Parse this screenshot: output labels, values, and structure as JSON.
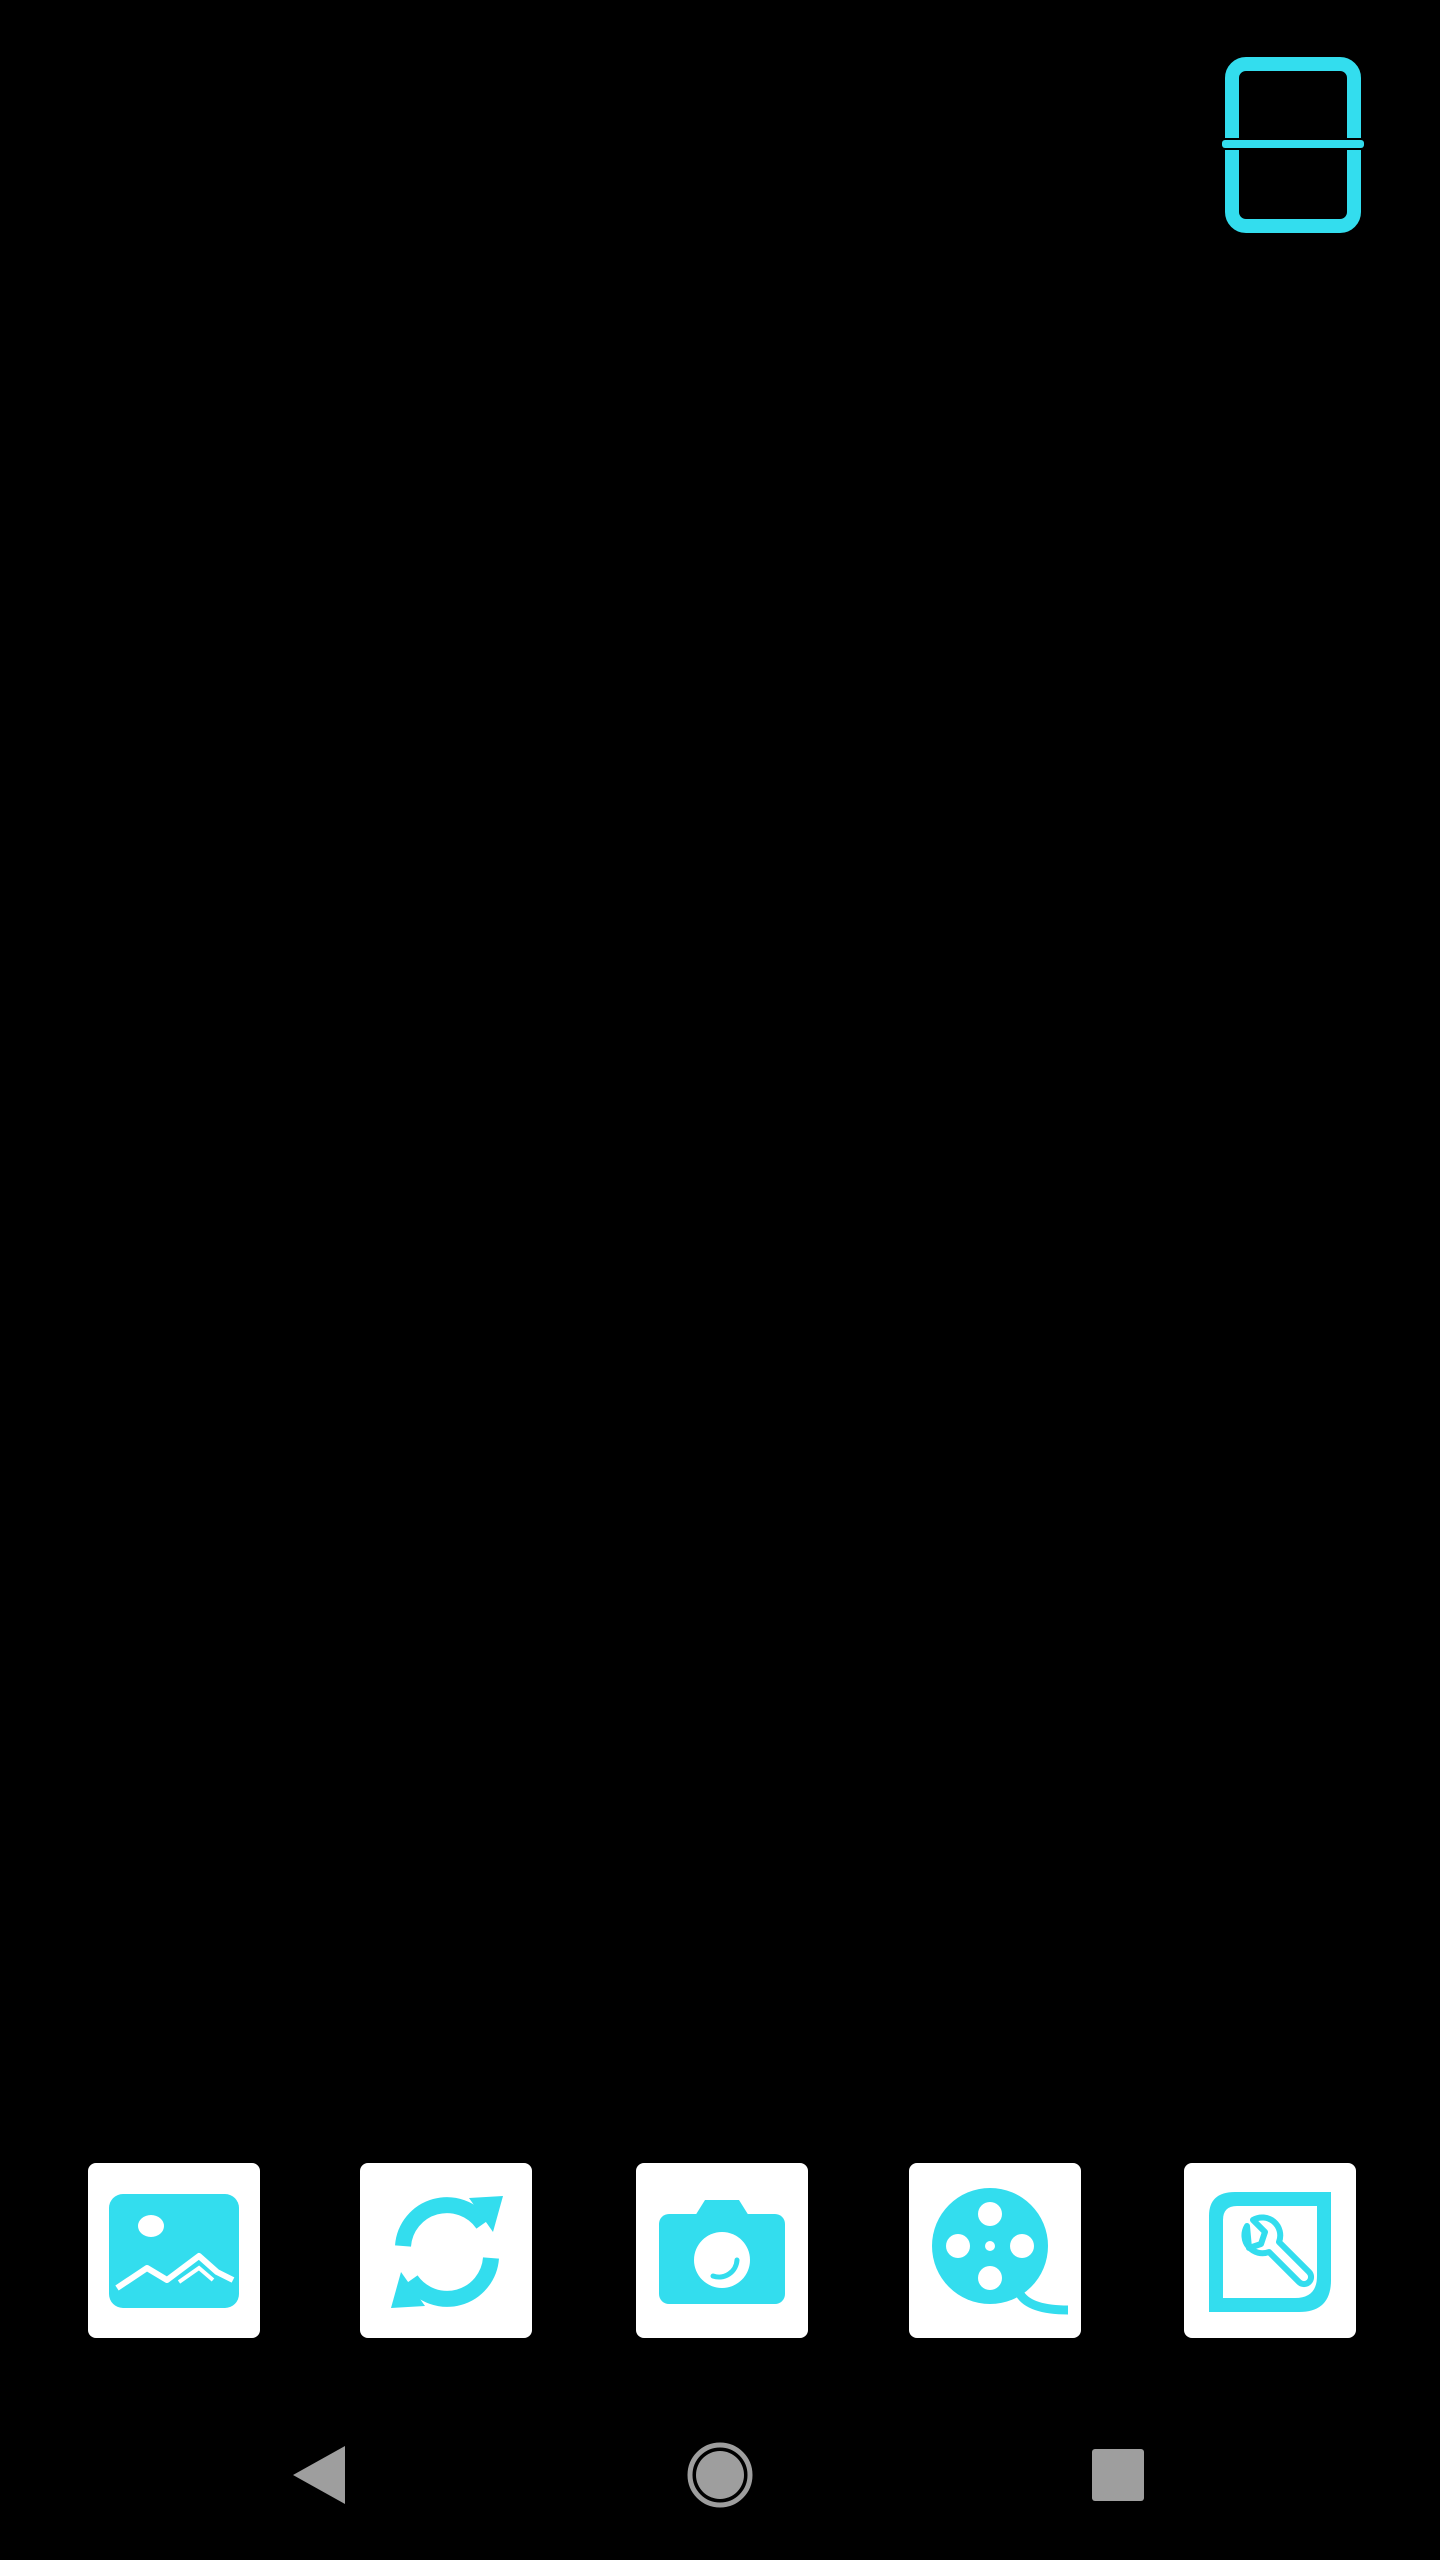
{
  "colors": {
    "background": "#000000",
    "accent": "#33DDEE",
    "button_bg": "#FFFFFF",
    "nav_icon": "#9E9E9E"
  },
  "top_bar": {
    "scan_toggle_icon": "scan-frame-icon"
  },
  "toolbar": {
    "items": [
      {
        "id": "gallery",
        "icon": "gallery-image-icon"
      },
      {
        "id": "switch_camera",
        "icon": "refresh-arrows-icon"
      },
      {
        "id": "capture",
        "icon": "camera-icon"
      },
      {
        "id": "video",
        "icon": "film-reel-icon"
      },
      {
        "id": "tools",
        "icon": "wrench-tools-icon"
      }
    ]
  },
  "navbar": {
    "items": [
      {
        "id": "back",
        "icon": "back-triangle-icon"
      },
      {
        "id": "home",
        "icon": "home-circle-icon"
      },
      {
        "id": "recents",
        "icon": "recents-square-icon"
      }
    ]
  }
}
